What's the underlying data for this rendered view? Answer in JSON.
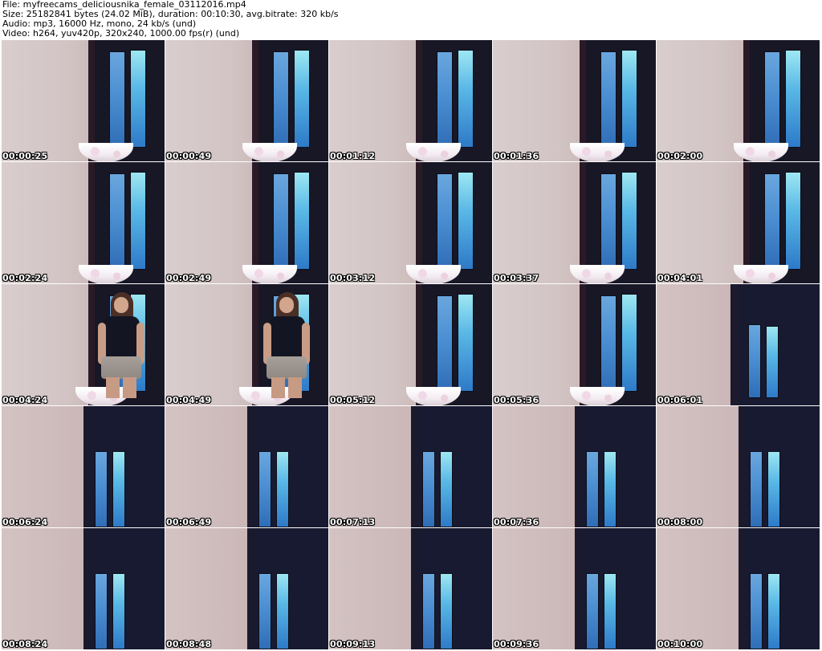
{
  "header": {
    "file": "File: myfreecams_deliciousnika_female_03112016.mp4",
    "size": "Size: 25182841 bytes (24.02 MiB), duration: 00:10:30, avg.bitrate: 320 kb/s",
    "audio": "Audio: mp3, 16000 Hz, mono, 24 kb/s (und)",
    "video": "Video: h264, yuv420p, 320x240, 1000.00 fps(r) (und)"
  },
  "thumbnails": [
    {
      "time": "00:00:25",
      "scene": "a",
      "person": false
    },
    {
      "time": "00:00:49",
      "scene": "a",
      "person": false
    },
    {
      "time": "00:01:12",
      "scene": "a",
      "person": false
    },
    {
      "time": "00:01:36",
      "scene": "a",
      "person": false
    },
    {
      "time": "00:02:00",
      "scene": "a",
      "person": false
    },
    {
      "time": "00:02:24",
      "scene": "a",
      "person": false
    },
    {
      "time": "00:02:49",
      "scene": "a",
      "person": false
    },
    {
      "time": "00:03:12",
      "scene": "a",
      "person": false
    },
    {
      "time": "00:03:37",
      "scene": "a",
      "person": false
    },
    {
      "time": "00:04:01",
      "scene": "a",
      "person": false
    },
    {
      "time": "00:04:24",
      "scene": "a",
      "person": true
    },
    {
      "time": "00:04:49",
      "scene": "a",
      "person": true
    },
    {
      "time": "00:05:12",
      "scene": "a",
      "person": false
    },
    {
      "time": "00:05:36",
      "scene": "a",
      "person": false
    },
    {
      "time": "00:06:01",
      "scene": "b",
      "person": false
    },
    {
      "time": "00:06:24",
      "scene": "c",
      "person": false
    },
    {
      "time": "00:06:49",
      "scene": "c",
      "person": false
    },
    {
      "time": "00:07:13",
      "scene": "c",
      "person": false
    },
    {
      "time": "00:07:36",
      "scene": "c",
      "person": false
    },
    {
      "time": "00:08:00",
      "scene": "c",
      "person": false
    },
    {
      "time": "00:08:24",
      "scene": "c",
      "person": false
    },
    {
      "time": "00:08:48",
      "scene": "c",
      "person": false
    },
    {
      "time": "00:09:13",
      "scene": "c",
      "person": false
    },
    {
      "time": "00:09:36",
      "scene": "c",
      "person": false
    },
    {
      "time": "00:10:00",
      "scene": "c",
      "person": false
    }
  ]
}
